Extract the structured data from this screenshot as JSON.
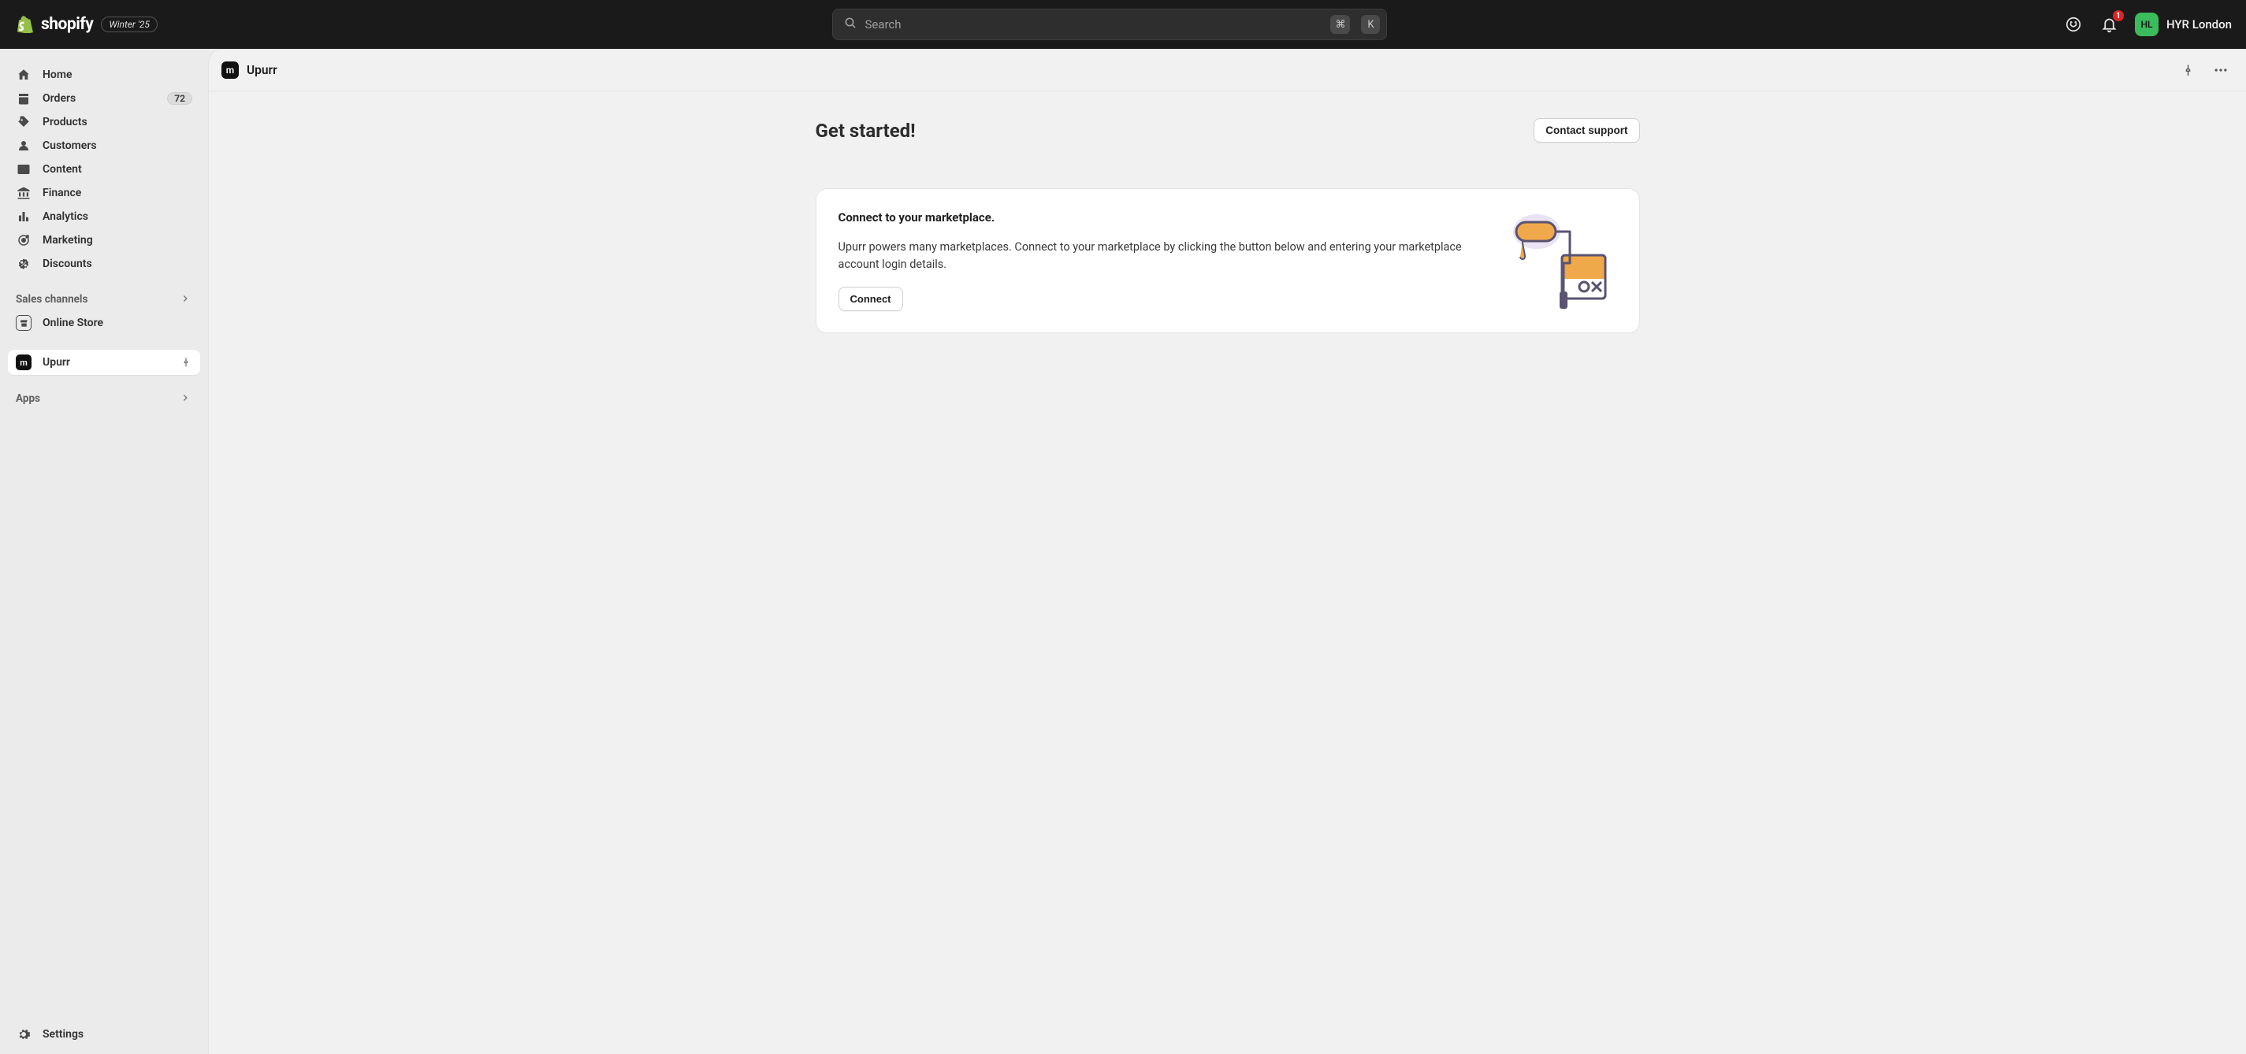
{
  "topbar": {
    "brand_word": "shopify",
    "edition": "Winter '25",
    "search_placeholder": "Search",
    "shortcut_keys": [
      "⌘",
      "K"
    ],
    "notifications_count": "1",
    "avatar_initials": "HL",
    "store_name": "HYR London"
  },
  "sidebar": {
    "nav": [
      {
        "id": "home",
        "label": "Home",
        "icon": "home"
      },
      {
        "id": "orders",
        "label": "Orders",
        "icon": "orders",
        "badge": "72"
      },
      {
        "id": "products",
        "label": "Products",
        "icon": "tag"
      },
      {
        "id": "customers",
        "label": "Customers",
        "icon": "person"
      },
      {
        "id": "content",
        "label": "Content",
        "icon": "image"
      },
      {
        "id": "finance",
        "label": "Finance",
        "icon": "bank"
      },
      {
        "id": "analytics",
        "label": "Analytics",
        "icon": "chart"
      },
      {
        "id": "marketing",
        "label": "Marketing",
        "icon": "target"
      },
      {
        "id": "discounts",
        "label": "Discounts",
        "icon": "discount"
      }
    ],
    "sales_channels_header": "Sales channels",
    "sales_channels": [
      {
        "id": "online-store",
        "label": "Online Store",
        "icon": "store"
      }
    ],
    "apps": [
      {
        "id": "upurr",
        "label": "Upurr",
        "active": true,
        "initial": "m"
      }
    ],
    "apps_header": "Apps",
    "settings_label": "Settings"
  },
  "page": {
    "app_name": "Upurr",
    "app_initial": "m",
    "hero_title": "Get started!",
    "contact_button": "Contact support",
    "card": {
      "heading": "Connect to your marketplace.",
      "body": "Upurr powers many marketplaces. Connect to your marketplace by clicking the button below and entering your marketplace account login details.",
      "connect_button": "Connect"
    }
  }
}
